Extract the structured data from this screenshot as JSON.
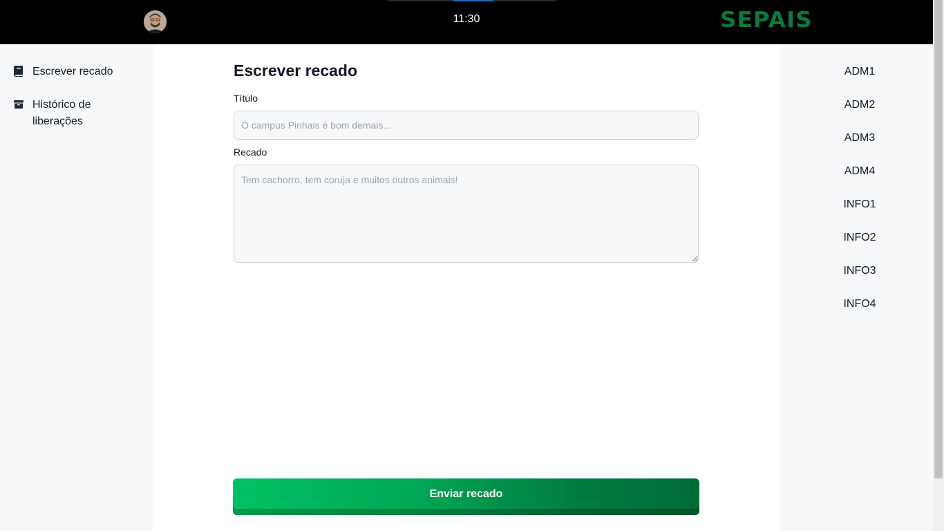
{
  "header": {
    "clock": "11:30",
    "logo": "SEPAIS",
    "progress": 0.24,
    "avatar_alt": "user avatar"
  },
  "sidebar": {
    "items": [
      {
        "label": "Escrever recado",
        "icon": "book-icon"
      },
      {
        "label": "Histórico de liberações",
        "icon": "archive-icon"
      }
    ]
  },
  "main": {
    "title": "Escrever recado",
    "titulo_label": "Título",
    "titulo_placeholder": "O campus Pinhais é bom demais...",
    "titulo_value": "",
    "recado_label": "Recado",
    "recado_placeholder": "Tem cachorro, tem coruja e muitos outros animais!",
    "recado_value": "",
    "submit_label": "Enviar recado"
  },
  "rooms": {
    "items": [
      "ADM1",
      "ADM2",
      "ADM3",
      "ADM4",
      "INFO1",
      "INFO2",
      "INFO3",
      "INFO4"
    ]
  },
  "colors": {
    "topbar": "#000000",
    "brand_green": "#0b7a3e",
    "button_start": "#00c165",
    "button_end": "#006b37",
    "sidebar_bg": "#f7f8fa"
  }
}
